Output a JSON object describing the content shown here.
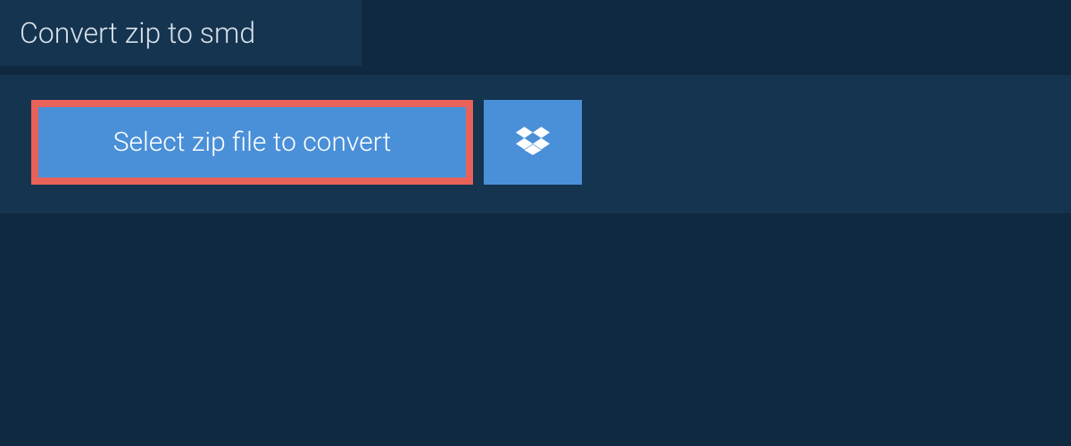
{
  "tab": {
    "title": "Convert zip to smd"
  },
  "actions": {
    "select_file_label": "Select zip file to convert"
  },
  "colors": {
    "background": "#0f2a40",
    "panel": "#153450",
    "button": "#4a90d9",
    "highlight_border": "#e86259",
    "text_light": "#d8e2ea",
    "text_white": "#ffffff"
  }
}
